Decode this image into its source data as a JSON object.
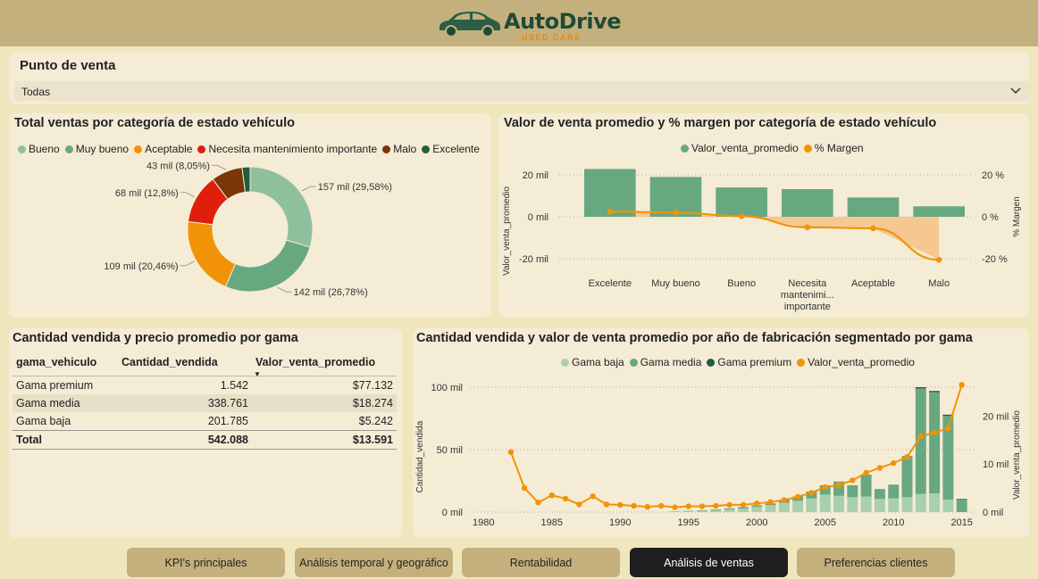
{
  "header": {
    "brand": "AutoDrive",
    "brand_sub": "USED CARS",
    "car_icon": "car-icon"
  },
  "slicer": {
    "title": "Punto de venta",
    "value": "Todas",
    "chevron": "chevron-down-icon"
  },
  "donut": {
    "title": "Total ventas por categoría de estado vehículo",
    "legend": [
      {
        "label": "Bueno",
        "color": "#8fc09e"
      },
      {
        "label": "Muy bueno",
        "color": "#68a880"
      },
      {
        "label": "Aceptable",
        "color": "#f29307"
      },
      {
        "label": "Necesita mantenimiento importante",
        "color": "#de1f0b"
      },
      {
        "label": "Malo",
        "color": "#7a3508"
      },
      {
        "label": "Excelente",
        "color": "#235c3e"
      }
    ],
    "data_labels": [
      "157 mil (29,58%)",
      "142 mil (26,78%)",
      "109 mil (20,46%)",
      "68 mil (12,8%)",
      "43 mil (8,05%)"
    ]
  },
  "combo": {
    "title": "Valor de venta promedio y % margen por categoría de estado vehículo",
    "legend": [
      {
        "label": "Valor_venta_promedio",
        "color": "#68a880"
      },
      {
        "label": "% Margen",
        "color": "#f29307"
      }
    ],
    "y_left_title": "Valor_venta_promedio",
    "y_right_title": "% Margen",
    "y_left_ticks": [
      "20 mil",
      "0 mil",
      "-20 mil"
    ],
    "y_right_ticks": [
      "20 %",
      "0 %",
      "-20 %"
    ],
    "categories": [
      "Excelente",
      "Muy bueno",
      "Bueno",
      "Necesita mantenimi... importante",
      "Aceptable",
      "Malo"
    ],
    "category_lines": [
      [
        "Excelente"
      ],
      [
        "Muy bueno"
      ],
      [
        "Bueno"
      ],
      [
        "Necesita",
        "mantenimi...",
        "importante"
      ],
      [
        "Aceptable"
      ],
      [
        "Malo"
      ]
    ]
  },
  "table": {
    "title": "Cantidad vendida y precio promedio por gama",
    "headers": [
      "gama_vehiculo",
      "Cantidad_vendida",
      "Valor_venta_promedio"
    ],
    "rows": [
      [
        "Gama premium",
        "1.542",
        "$77.132"
      ],
      [
        "Gama media",
        "338.761",
        "$18.274"
      ],
      [
        "Gama baja",
        "201.785",
        "$5.242"
      ]
    ],
    "total": [
      "Total",
      "542.088",
      "$13.591"
    ]
  },
  "bar_line": {
    "title": "Cantidad vendida y valor de venta promedio por año de fabricación segmentado por gama",
    "legend": [
      {
        "label": "Gama baja",
        "color": "#a8cfae"
      },
      {
        "label": "Gama media",
        "color": "#68a880"
      },
      {
        "label": "Gama premium",
        "color": "#235c3e"
      },
      {
        "label": "Valor_venta_promedio",
        "color": "#f29307"
      }
    ],
    "y_left_title": "Cantidad_vendida",
    "y_right_title": "Valor_venta_promedio",
    "y_left_ticks": [
      "100 mil",
      "50 mil",
      "0 mil"
    ],
    "y_right_ticks": [
      "20 mil",
      "10 mil",
      "0 mil"
    ],
    "x_ticks": [
      "1980",
      "1985",
      "1990",
      "1995",
      "2000",
      "2005",
      "2010",
      "2015"
    ]
  },
  "tabs": [
    {
      "label": "KPI's principales",
      "active": false
    },
    {
      "label": "Análisis temporal y geográfico",
      "active": false
    },
    {
      "label": "Rentabilidad",
      "active": false
    },
    {
      "label": "Análisis de ventas",
      "active": true
    },
    {
      "label": "Preferencias clientes",
      "active": false
    }
  ],
  "chart_data": [
    {
      "type": "pie",
      "title": "Total ventas por categoría de estado vehículo",
      "categories": [
        "Bueno",
        "Muy bueno",
        "Aceptable",
        "Necesita mantenimiento importante",
        "Malo",
        "Excelente"
      ],
      "values": [
        157000,
        142000,
        109000,
        68000,
        43000,
        11000
      ],
      "percent": [
        29.58,
        26.78,
        20.46,
        12.8,
        8.05,
        2.33
      ],
      "colors": [
        "#8fc09e",
        "#68a880",
        "#f29307",
        "#de1f0b",
        "#7a3508",
        "#235c3e"
      ],
      "legend_position": "top-left"
    },
    {
      "type": "bar",
      "title": "Valor de venta promedio y % margen por categoría de estado vehículo",
      "categories": [
        "Excelente",
        "Muy bueno",
        "Bueno",
        "Necesita mantenimiento importante",
        "Aceptable",
        "Malo"
      ],
      "series": [
        {
          "name": "Valor_venta_promedio",
          "type": "bar",
          "axis": "left",
          "values": [
            22800,
            19000,
            14000,
            13200,
            9200,
            5000
          ]
        },
        {
          "name": "% Margen",
          "type": "line",
          "axis": "right",
          "values": [
            2.5,
            2,
            0.3,
            -5,
            -5.5,
            -20.5
          ]
        }
      ],
      "ylabel": "Valor_venta_promedio",
      "ylabel_right": "% Margen",
      "ylim": [
        -25000,
        25000
      ],
      "ylim_right": [
        -25,
        25
      ],
      "grid": true,
      "legend_position": "top-center"
    },
    {
      "type": "bar",
      "stacked": true,
      "title": "Cantidad vendida y valor de venta promedio por año de fabricación segmentado por gama",
      "x": [
        1982,
        1983,
        1984,
        1985,
        1986,
        1987,
        1988,
        1989,
        1990,
        1991,
        1992,
        1993,
        1994,
        1995,
        1996,
        1997,
        1998,
        1999,
        2000,
        2001,
        2002,
        2003,
        2004,
        2005,
        2006,
        2007,
        2008,
        2009,
        2010,
        2011,
        2012,
        2013,
        2014,
        2015
      ],
      "series": [
        {
          "name": "Gama baja",
          "values": [
            0,
            0,
            0,
            0,
            0,
            0,
            0,
            0,
            0,
            0,
            0,
            0,
            200,
            600,
            1000,
            1500,
            2200,
            2800,
            4200,
            5500,
            7500,
            9000,
            11000,
            14000,
            13000,
            12000,
            12500,
            10500,
            11000,
            12000,
            14500,
            15000,
            10000,
            0
          ]
        },
        {
          "name": "Gama media",
          "values": [
            0,
            0,
            0,
            0,
            0,
            0,
            0,
            0,
            0,
            0,
            0,
            0,
            300,
            400,
            500,
            600,
            800,
            1200,
            1200,
            1500,
            2500,
            3500,
            5500,
            7500,
            11500,
            9500,
            17500,
            8000,
            11000,
            33000,
            84500,
            81000,
            67000,
            10000
          ]
        },
        {
          "name": "Gama premium",
          "values": [
            0,
            0,
            0,
            0,
            0,
            0,
            0,
            0,
            0,
            0,
            0,
            0,
            0,
            0,
            0,
            0,
            0,
            0,
            0,
            0,
            0,
            0,
            0,
            0,
            0,
            0,
            0,
            0,
            0,
            0,
            1000,
            1000,
            1000,
            500
          ]
        },
        {
          "name": "Valor_venta_promedio",
          "type": "line",
          "axis": "right",
          "values": [
            12500,
            5000,
            2000,
            3500,
            2800,
            1600,
            3300,
            1600,
            1500,
            1300,
            1100,
            1300,
            1000,
            1200,
            1200,
            1300,
            1500,
            1500,
            1800,
            2100,
            2500,
            3200,
            4000,
            5200,
            5600,
            6600,
            8200,
            9200,
            10200,
            11500,
            15800,
            16500,
            17500,
            26500
          ]
        }
      ],
      "ylabel": "Cantidad_vendida",
      "ylabel_right": "Valor_venta_promedio",
      "ylim": [
        0,
        100000
      ],
      "ylim_right": [
        0,
        27500
      ],
      "xlim": [
        1979,
        2016
      ],
      "grid": true,
      "legend_position": "top-center"
    }
  ]
}
